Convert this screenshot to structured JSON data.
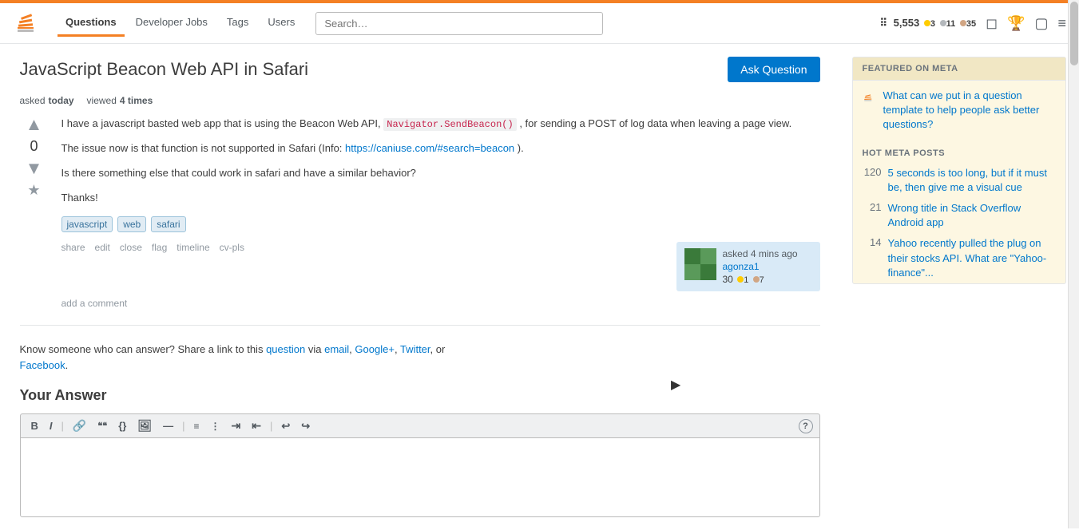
{
  "top_bar": {
    "nav": {
      "questions": "Questions",
      "developer_jobs": "Developer Jobs",
      "tags": "Tags",
      "users": "Users"
    },
    "search": {
      "placeholder": "Search…",
      "value": ""
    },
    "user": {
      "reputation": "5,553",
      "gold": "3",
      "silver": "11",
      "bronze": "35"
    },
    "icons": [
      "grid-icon",
      "inbox-icon",
      "trophy-icon",
      "review-icon",
      "hamburger-icon"
    ]
  },
  "page": {
    "title": "JavaScript Beacon Web API in Safari",
    "ask_button": "Ask Question"
  },
  "question": {
    "meta": {
      "asked_label": "asked",
      "asked_value": "today",
      "viewed_label": "viewed",
      "viewed_value": "4 times"
    },
    "vote_count": "0",
    "body": {
      "paragraph1_start": "I have a javascript basted web app that is using the Beacon Web API,",
      "code_inline": "Navigator.SendBeacon()",
      "paragraph1_end": ", for sending a POST of log data when leaving a page view.",
      "paragraph2": "The issue now is that function is not supported in Safari (Info:",
      "link_text": "https://caniuse.com/#search=beacon",
      "link_href": "https://caniuse.com/#search=beacon",
      "paragraph2_end": ").",
      "paragraph3": "Is there something else that could work in safari and have a similar behavior?",
      "paragraph4": "Thanks!"
    },
    "tags": [
      "javascript",
      "web",
      "safari"
    ],
    "actions": {
      "share": "share",
      "edit": "edit",
      "close": "close",
      "flag": "flag",
      "timeline": "timeline",
      "cv_pls": "cv-pls"
    },
    "user_card": {
      "asked_when": "asked 4 mins ago",
      "username": "agonza1",
      "rep": "30",
      "gold": "1",
      "silver": "7"
    },
    "add_comment": "add a comment"
  },
  "share_section": {
    "text_before": "Know someone who can answer? Share a link to this",
    "question_link": "question",
    "text_via": "via",
    "email_link": "email",
    "googleplus_link": "Google+",
    "twitter_link": "Twitter",
    "text_or": "or",
    "facebook_link": "Facebook"
  },
  "your_answer": {
    "title": "Your Answer",
    "toolbar": {
      "bold": "B",
      "italic": "I",
      "link": "🔗",
      "blockquote": "❝❝",
      "code": "{}",
      "image": "🖼",
      "horizontal": "—",
      "ol": "ol",
      "ul": "ul",
      "indent": "indent",
      "outdent": "outdent",
      "undo": "↩",
      "redo": "↪",
      "help": "?"
    }
  },
  "sidebar": {
    "featured": {
      "header": "FEATURED ON META",
      "item": {
        "link_text": "What can we put in a question template to help people ask better questions?"
      }
    },
    "hot_meta": {
      "header": "HOT META POSTS",
      "items": [
        {
          "count": "120",
          "link_text": "5 seconds is too long, but if it must be, then give me a visual cue"
        },
        {
          "count": "21",
          "link_text": "Wrong title in Stack Overflow Android app"
        },
        {
          "count": "14",
          "link_text": "Yahoo recently pulled the plug on their stocks API. What are \"Yahoo-finance\"..."
        }
      ]
    }
  }
}
